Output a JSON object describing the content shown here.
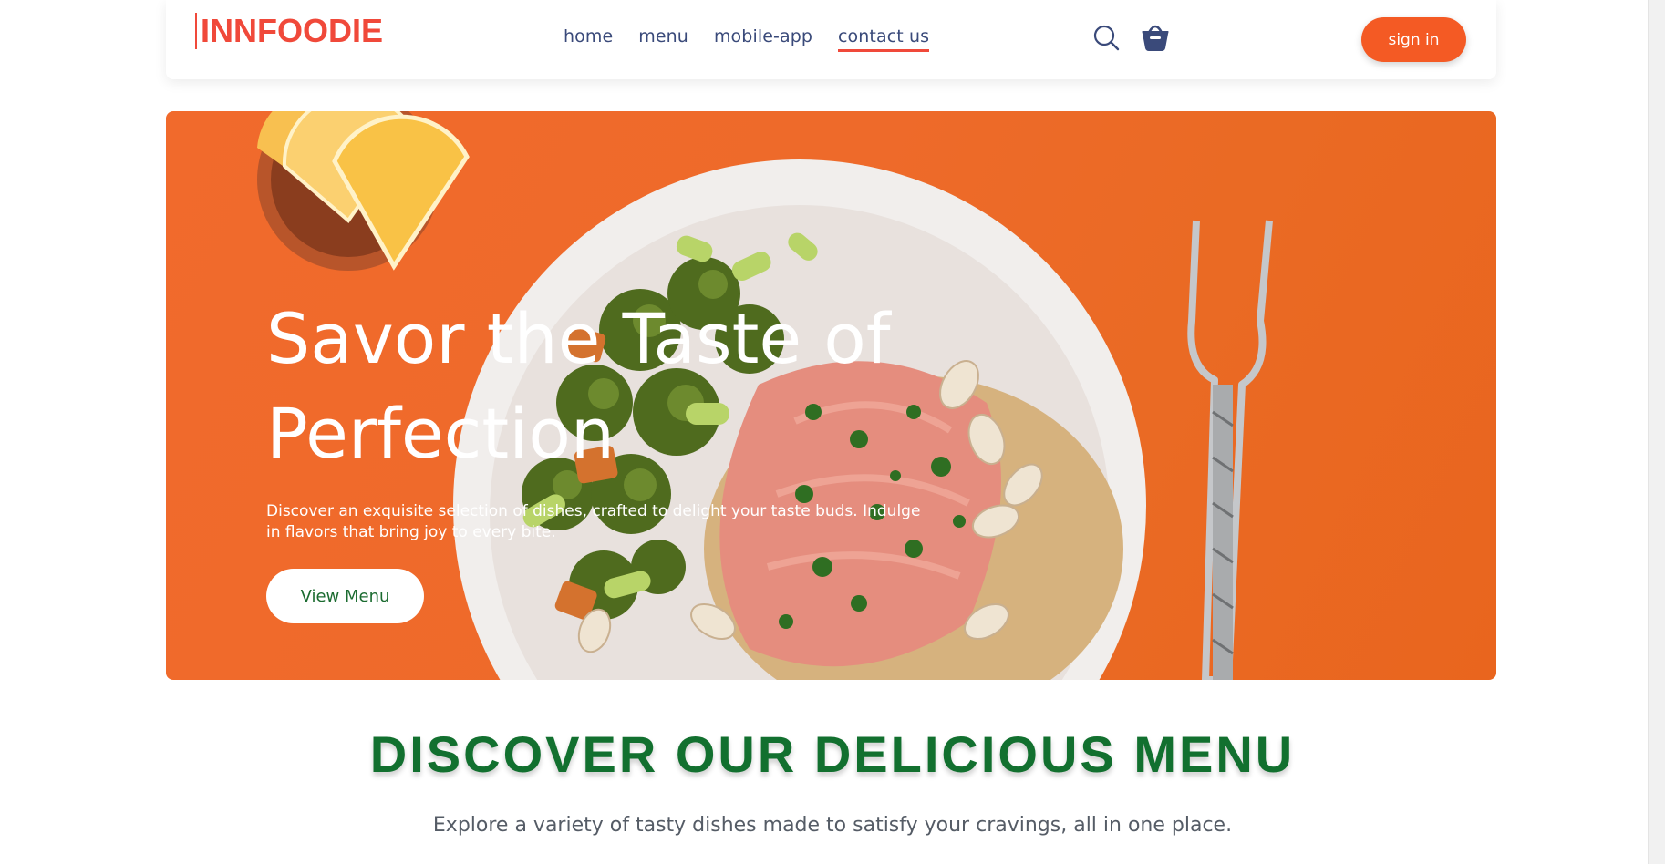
{
  "brand": {
    "logo_text": "INNFOODIE"
  },
  "nav": {
    "links": [
      {
        "label": "home"
      },
      {
        "label": "menu"
      },
      {
        "label": "mobile-app"
      },
      {
        "label": "contact us"
      }
    ],
    "active_link": "contact us",
    "icons": [
      "search-icon",
      "basket-icon"
    ],
    "signin_label": "sign in"
  },
  "hero": {
    "title_line1": "Savor the Taste of",
    "title_line2": "Perfection",
    "description": "Discover an exquisite selection of dishes, crafted to delight your taste buds. Indulge in flavors that bring joy to every bite.",
    "cta_label": "View Menu",
    "background_color": "#ef6a28"
  },
  "menu_section": {
    "title": "DISCOVER OUR DELICIOUS MENU",
    "subtitle": "Explore a variety of tasty dishes made to satisfy your cravings, all in one place."
  },
  "colors": {
    "accent": "#f0493a",
    "button_orange": "#f45a24",
    "nav_text": "#3a4a7a",
    "heading_green": "#12702f"
  }
}
